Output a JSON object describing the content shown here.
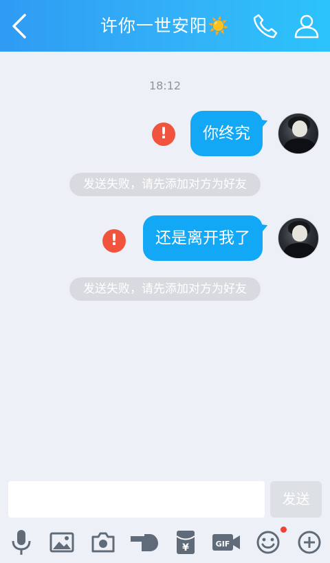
{
  "header": {
    "title": "许你一世安阳",
    "title_emoji": "☀️",
    "back_icon": "chevron-left-icon",
    "call_icon": "phone-icon",
    "profile_icon": "user-icon"
  },
  "timestamp": "18:12",
  "messages": [
    {
      "text": "你终究",
      "status": "failed"
    },
    {
      "text": "还是离开我了",
      "status": "failed"
    }
  ],
  "notices": [
    "发送失败，请先添加对方为好友",
    "发送失败，请先添加对方为好友"
  ],
  "input": {
    "value": "",
    "placeholder": ""
  },
  "send_label": "发送",
  "toolbar": [
    "microphone-icon",
    "image-icon",
    "camera-icon",
    "poke-hand-icon",
    "red-packet-icon",
    "gif-icon",
    "emoji-icon",
    "plus-icon"
  ],
  "colors": {
    "header": "#2f9bf3",
    "bubble": "#12a8f5",
    "error": "#f0543e",
    "notice": "#d8dadf",
    "background": "#edf1f7"
  }
}
